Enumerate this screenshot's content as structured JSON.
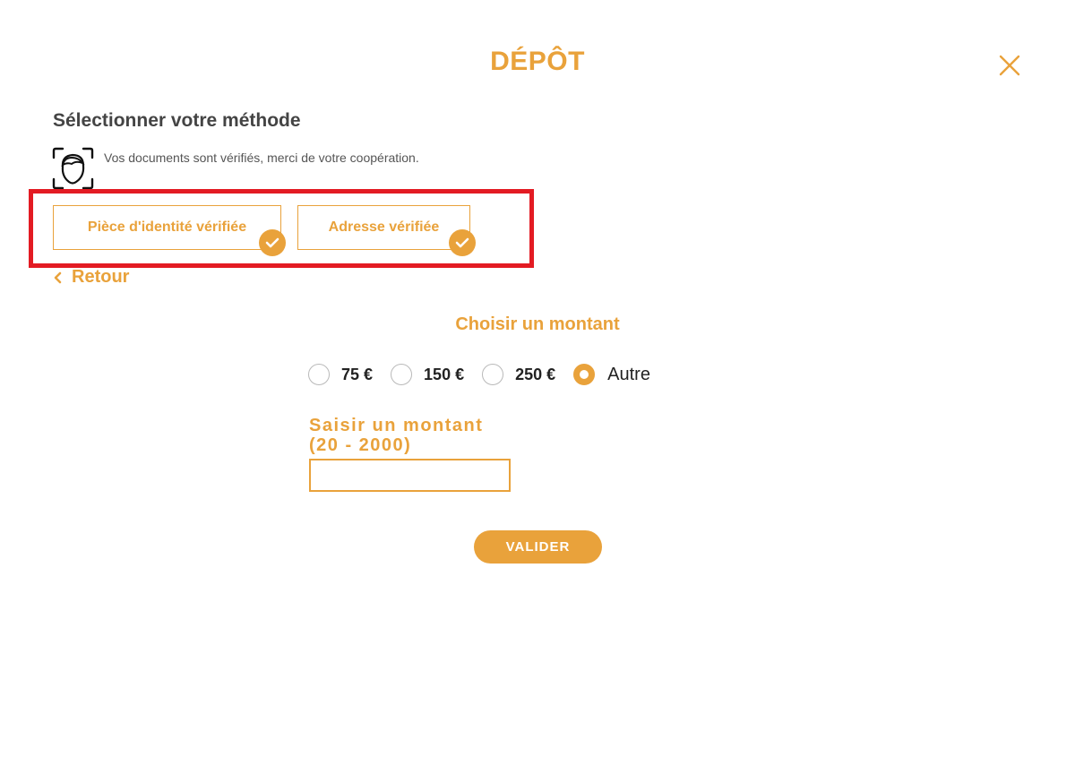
{
  "modal": {
    "title": "DÉPÔT",
    "close_icon": "close-icon"
  },
  "method": {
    "section_title": "Sélectionner votre méthode",
    "verification_note": "Vos documents sont vérifiés, merci de votre coopération.",
    "face_icon": "face-scan-icon",
    "documents": [
      {
        "label": "Pièce d'identité vérifiée",
        "status_icon": "check-icon"
      },
      {
        "label": "Adresse vérifiée",
        "status_icon": "check-icon"
      }
    ],
    "highlight_color": "#e31b23"
  },
  "nav": {
    "back_label": "Retour",
    "back_icon": "chevron-left-icon"
  },
  "amount": {
    "title": "Choisir un montant",
    "options": [
      {
        "label": "75 €",
        "selected": false
      },
      {
        "label": "150 €",
        "selected": false
      },
      {
        "label": "250 €",
        "selected": false
      },
      {
        "label": "Autre",
        "selected": true
      }
    ],
    "input_label_line1": "Saisir un montant",
    "input_label_line2": "(20 - 2000)",
    "input_value": "",
    "submit_label": "VALIDER"
  },
  "colors": {
    "accent": "#e9a23b",
    "text": "#444444"
  }
}
